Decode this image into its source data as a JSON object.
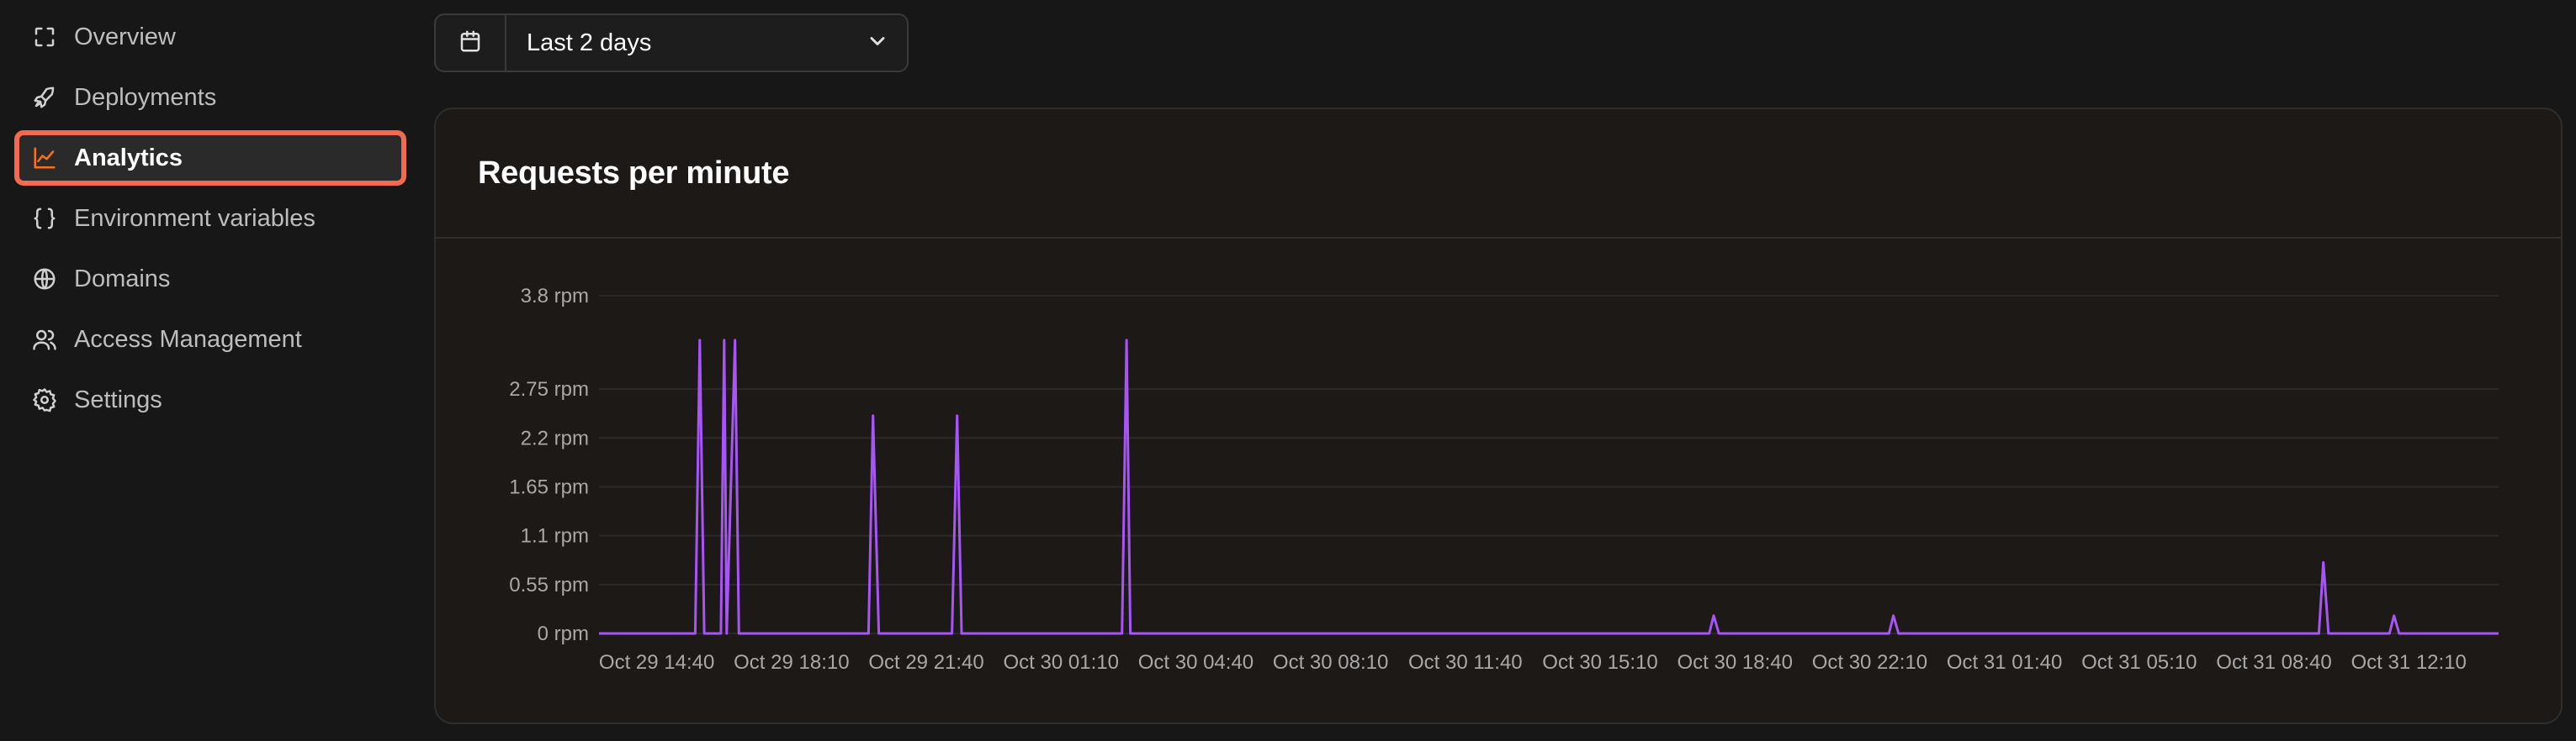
{
  "sidebar": {
    "items": [
      {
        "label": "Overview",
        "icon": "focus-corners-icon",
        "active": false
      },
      {
        "label": "Deployments",
        "icon": "rocket-icon",
        "active": false
      },
      {
        "label": "Analytics",
        "icon": "line-chart-icon",
        "active": true
      },
      {
        "label": "Environment variables",
        "icon": "braces-icon",
        "active": false
      },
      {
        "label": "Domains",
        "icon": "globe-icon",
        "active": false
      },
      {
        "label": "Access Management",
        "icon": "users-icon",
        "active": false
      },
      {
        "label": "Settings",
        "icon": "gear-icon",
        "active": false
      }
    ]
  },
  "date_picker": {
    "value": "Last 2 days",
    "icon": "calendar-icon",
    "dropdown_icon": "chevron-down-icon"
  },
  "card": {
    "title": "Requests per minute"
  },
  "colors": {
    "accent": "#f26a4f",
    "series": "#a855f7",
    "active_icon": "#f97316"
  },
  "chart_data": {
    "type": "line",
    "title": "Requests per minute",
    "y_ticks": [
      {
        "value": 0,
        "label": "0 rpm"
      },
      {
        "value": 0.55,
        "label": "0.55 rpm"
      },
      {
        "value": 1.1,
        "label": "1.1 rpm"
      },
      {
        "value": 1.65,
        "label": "1.65 rpm"
      },
      {
        "value": 2.2,
        "label": "2.2 rpm"
      },
      {
        "value": 2.75,
        "label": "2.75 rpm"
      },
      {
        "value": 3.8,
        "label": "3.8 rpm"
      }
    ],
    "ylim": [
      0,
      3.8
    ],
    "x_ticks": [
      "Oct 29 14:40",
      "Oct 29 18:10",
      "Oct 29 21:40",
      "Oct 30 01:10",
      "Oct 30 04:40",
      "Oct 30 08:10",
      "Oct 30 11:40",
      "Oct 30 15:10",
      "Oct 30 18:40",
      "Oct 30 22:10",
      "Oct 31 01:40",
      "Oct 31 05:10",
      "Oct 31 08:40",
      "Oct 31 12:10"
    ],
    "x_tick_step_minutes": 210,
    "x_range_minutes": [
      -90,
      2870
    ],
    "series": [
      {
        "name": "",
        "points": [
          [
            -90,
            0
          ],
          [
            60,
            0
          ],
          [
            67,
            3.3
          ],
          [
            74,
            0
          ],
          [
            100,
            0
          ],
          [
            105,
            3.3
          ],
          [
            109,
            0
          ],
          [
            122,
            3.3
          ],
          [
            128,
            0
          ],
          [
            330,
            0
          ],
          [
            337,
            2.45
          ],
          [
            346,
            0
          ],
          [
            460,
            0
          ],
          [
            468,
            2.45
          ],
          [
            475,
            0
          ],
          [
            725,
            0
          ],
          [
            732,
            3.3
          ],
          [
            738,
            0
          ],
          [
            1640,
            0
          ],
          [
            1647,
            0.2
          ],
          [
            1655,
            0
          ],
          [
            1920,
            0
          ],
          [
            1927,
            0.2
          ],
          [
            1935,
            0
          ],
          [
            2590,
            0
          ],
          [
            2597,
            0.8
          ],
          [
            2605,
            0
          ],
          [
            2700,
            0
          ],
          [
            2707,
            0.2
          ],
          [
            2715,
            0
          ],
          [
            2870,
            0
          ]
        ]
      }
    ],
    "grid": true,
    "legend": "none"
  }
}
